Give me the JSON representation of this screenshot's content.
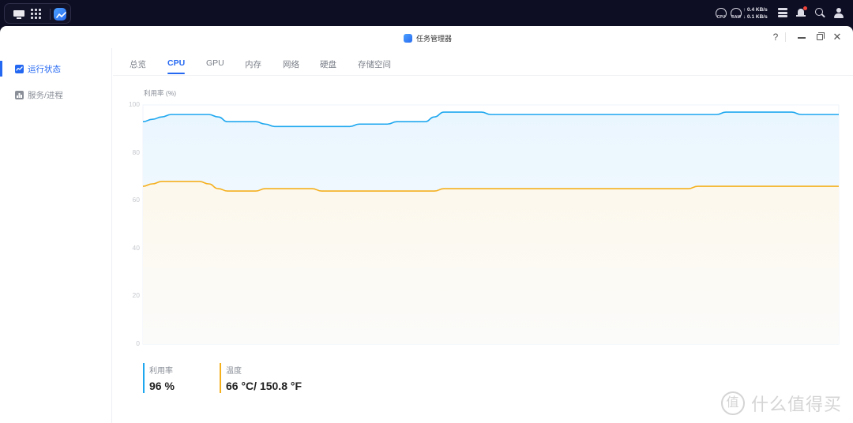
{
  "taskbar": {
    "dock_icons": [
      "desktop-icon",
      "app-grid-icon",
      "task-manager-app-icon"
    ],
    "cpu_label": "CPU",
    "ram_label": "RAM",
    "net_up": "↑ 0.4 KB/s",
    "net_down": "↓ 0.1 KB/s",
    "tray_icons": [
      "storage-icon",
      "bell-icon",
      "search-icon",
      "user-icon"
    ],
    "notification_dot_color": "#f0443a"
  },
  "window": {
    "title": "任务管理器",
    "help_label": "?",
    "close_label": "✕"
  },
  "sidebar": {
    "items": [
      {
        "label": "运行状态",
        "icon": "chart-icon",
        "active": true
      },
      {
        "label": "服务/进程",
        "icon": "services-icon",
        "active": false
      }
    ]
  },
  "tabs": [
    {
      "label": "总览",
      "active": false
    },
    {
      "label": "CPU",
      "active": true
    },
    {
      "label": "GPU",
      "active": false
    },
    {
      "label": "内存",
      "active": false
    },
    {
      "label": "网络",
      "active": false
    },
    {
      "label": "硬盘",
      "active": false
    },
    {
      "label": "存储空间",
      "active": false
    }
  ],
  "colors": {
    "accent": "#2468f2",
    "utilization": "#1ea7ef",
    "temperature": "#f5b01e"
  },
  "chart_data": {
    "type": "area",
    "title": "",
    "ylabel": "利用率 (%)",
    "xlabel": "",
    "ylim": [
      0,
      100
    ],
    "yticks": [
      "0",
      "20",
      "40",
      "60",
      "80",
      "100"
    ],
    "grid": true,
    "legend": "bottom",
    "series": [
      {
        "name": "利用率",
        "color": "#1ea7ef",
        "values": [
          93,
          94,
          95,
          96,
          96,
          96,
          96,
          96,
          95,
          93,
          93,
          93,
          93,
          92,
          91,
          91,
          91,
          91,
          91,
          91,
          91,
          91,
          91,
          92,
          92,
          92,
          92,
          93,
          93,
          93,
          93,
          95,
          97,
          97,
          97,
          97,
          97,
          96,
          96,
          96,
          96,
          96,
          96,
          96,
          96,
          96,
          96,
          96,
          96,
          96,
          96,
          96,
          96,
          96,
          96,
          96,
          96,
          96,
          96,
          96,
          96,
          96,
          97,
          97,
          97,
          97,
          97,
          97,
          97,
          97,
          96,
          96,
          96,
          96,
          96
        ]
      },
      {
        "name": "温度",
        "color": "#f5b01e",
        "values": [
          66,
          67,
          68,
          68,
          68,
          68,
          68,
          67,
          65,
          64,
          64,
          64,
          64,
          65,
          65,
          65,
          65,
          65,
          65,
          64,
          64,
          64,
          64,
          64,
          64,
          64,
          64,
          64,
          64,
          64,
          64,
          64,
          65,
          65,
          65,
          65,
          65,
          65,
          65,
          65,
          65,
          65,
          65,
          65,
          65,
          65,
          65,
          65,
          65,
          65,
          65,
          65,
          65,
          65,
          65,
          65,
          65,
          65,
          65,
          66,
          66,
          66,
          66,
          66,
          66,
          66,
          66,
          66,
          66,
          66,
          66,
          66,
          66,
          66,
          66
        ]
      }
    ]
  },
  "stats": [
    {
      "label": "利用率",
      "value": "96 %",
      "color": "#1ea7ef"
    },
    {
      "label": "温度",
      "value": "66 °C/ 150.8 °F",
      "color": "#f5b01e"
    }
  ],
  "watermark": {
    "badge": "值",
    "text": "什么值得买"
  }
}
